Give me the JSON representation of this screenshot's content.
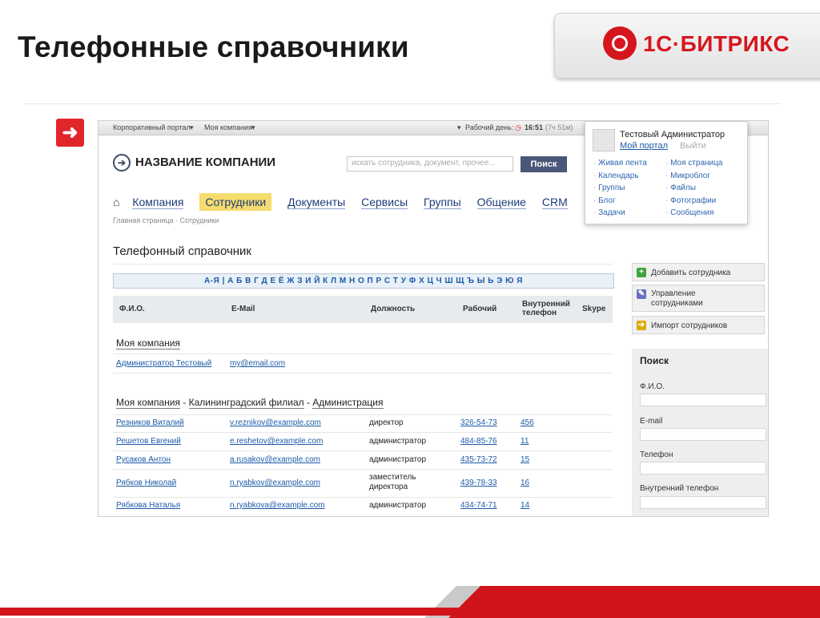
{
  "slide": {
    "title": "Телефонные справочники"
  },
  "logo": {
    "text": "1С·БИТРИКС"
  },
  "topbar": {
    "portal": "Корпоративный портал",
    "company": "Моя компания",
    "workday": "Рабочий день:",
    "time": "16:51",
    "timer": "(7ч 51м)"
  },
  "header": {
    "company_name": "НАЗВАНИЕ КОМПАНИИ",
    "search_placeholder": "искать сотрудника, документ, прочее...",
    "search_button": "Поиск"
  },
  "menu": {
    "home_icon": "home-icon",
    "items": [
      "Компания",
      "Сотрудники",
      "Документы",
      "Сервисы",
      "Группы",
      "Общение",
      "CRM"
    ],
    "active_index": 1
  },
  "breadcrumb": {
    "home": "Главная страница",
    "sep": "·",
    "current": "Сотрудники"
  },
  "user_menu": {
    "name": "Тестовый Администратор",
    "my_portal": "Мой портал",
    "logout": "Выйти",
    "left": [
      "Живая лента",
      "Календарь",
      "Группы",
      "Блог",
      "Задачи"
    ],
    "right": [
      "Моя страница",
      "Микроблог",
      "Файлы",
      "Фотографии",
      "Сообщения"
    ]
  },
  "section": {
    "title": "Телефонный справочник"
  },
  "alphabet": "А-Я | А Б В Г Д Е Ё Ж З И Й К Л М Н О П Р С Т У Ф Х Ц Ч Ш Щ Ъ Ы Ь Э Ю Я",
  "table": {
    "headers": {
      "name": "Ф.И.О.",
      "email": "E-Mail",
      "position": "Должность",
      "work": "Рабочий",
      "internal_1": "Внутренний",
      "internal_2": "телефон",
      "skype": "Skype"
    },
    "group1": "Моя компания",
    "group1_row": {
      "name": "Администратор Тестовый",
      "email": "my@email.com"
    },
    "group2": {
      "a": "Моя компания",
      "sep1": " - ",
      "b": "Калининградский филиал",
      "sep2": " - ",
      "c": "Администрация"
    },
    "rows": [
      {
        "name": "Резников Виталий",
        "email": "v.reznikov@example.com",
        "position": "директор",
        "work": "326-54-73",
        "internal": "456"
      },
      {
        "name": "Решетов Евгений",
        "email": "e.reshetov@example.com",
        "position": "администратор",
        "work": "484-85-76",
        "internal": "11"
      },
      {
        "name": "Русаков Антон",
        "email": "a.rusakov@example.com",
        "position": "администратор",
        "work": "435-73-72",
        "internal": "15"
      },
      {
        "name": "Рябков Николай",
        "email": "n.ryabkov@example.com",
        "position_1": "заместитель",
        "position_2": "директора",
        "work": "439-78-33",
        "internal": "16"
      },
      {
        "name": "Рябкова Наталья",
        "email": "n.ryabkova@example.com",
        "position": "администратор",
        "work": "434-74-71",
        "internal": "14"
      }
    ]
  },
  "side": {
    "add": "Добавить сотрудника",
    "manage_1": "Управление",
    "manage_2": "сотрудниками",
    "import": "Импорт сотрудников",
    "search_title": "Поиск",
    "fio": "Ф.И.О.",
    "email": "E-mail",
    "phone": "Телефон",
    "internal": "Внутренний телефон"
  },
  "colors": {
    "accent_red": "#d1141c",
    "menu_active": "#f5dc6e",
    "link": "#1d5ba8",
    "button": "#4a5778"
  }
}
